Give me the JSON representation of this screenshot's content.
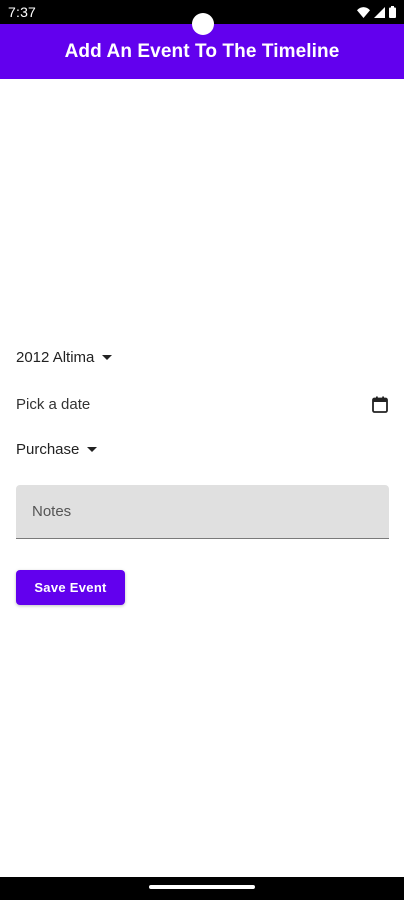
{
  "status_bar": {
    "time": "7:37",
    "icons": [
      "wifi-icon",
      "signal-icon",
      "battery-icon"
    ]
  },
  "app_bar": {
    "title": "Add An Event To The Timeline",
    "color": "#6200ee"
  },
  "form": {
    "vehicle_select": {
      "value": "2012 Altima",
      "icon": "chevron-down-icon"
    },
    "date_field": {
      "placeholder": "Pick a date",
      "icon": "calendar-icon"
    },
    "event_type_select": {
      "value": "Purchase",
      "icon": "chevron-down-icon"
    },
    "notes_field": {
      "placeholder": "Notes",
      "value": ""
    },
    "save_button": {
      "label": "Save Event"
    }
  }
}
